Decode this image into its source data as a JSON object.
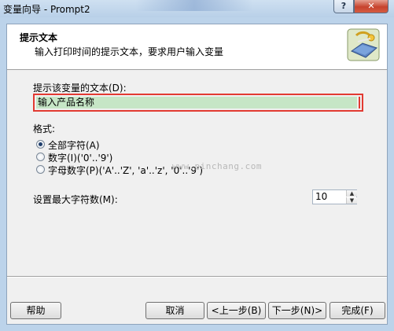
{
  "window": {
    "title": "变量向导 - Prompt2",
    "help_button": "?",
    "close_button": "✕"
  },
  "header": {
    "title": "提示文本",
    "subtitle": "输入打印时间的提示文本，要求用户输入变量"
  },
  "prompt_field": {
    "label": "提示该变量的文本(D):",
    "value": "输入产品名称"
  },
  "format": {
    "label": "格式:",
    "options": [
      {
        "label": "全部字符(A)",
        "selected": true
      },
      {
        "label": "数字(I)('0'..'9')",
        "selected": false
      },
      {
        "label": "字母数字(P)('A'..'Z', 'a'..'z', '0'..'9')",
        "selected": false
      }
    ]
  },
  "max_chars": {
    "label": "设置最大字符数(M):",
    "value": "10"
  },
  "watermark": "www.pinchang.com",
  "buttons": {
    "help": "帮助",
    "cancel": "取消",
    "back": "<上一步(B)",
    "next": "下一步(N)>",
    "finish": "完成(F)"
  },
  "colors": {
    "window_frame": "#bcd3ea",
    "highlight_border": "#e23a32",
    "input_background": "#c6e6c6"
  }
}
